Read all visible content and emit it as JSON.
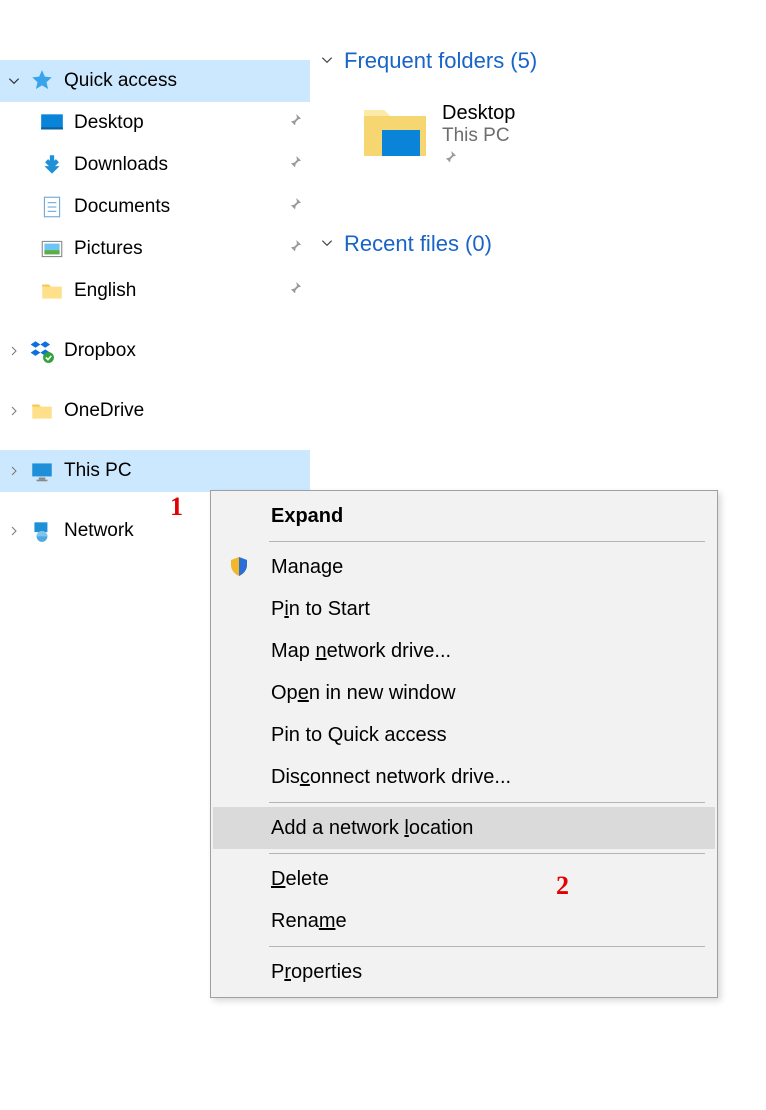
{
  "sidebar": {
    "quick_access": "Quick access",
    "items": [
      {
        "label": "Desktop"
      },
      {
        "label": "Downloads"
      },
      {
        "label": "Documents"
      },
      {
        "label": "Pictures"
      },
      {
        "label": "English"
      }
    ],
    "dropbox": "Dropbox",
    "onedrive": "OneDrive",
    "this_pc": "This PC",
    "network": "Network"
  },
  "content": {
    "frequent_hdr": "Frequent folders (5)",
    "recent_hdr": "Recent files (0)",
    "tile": {
      "name": "Desktop",
      "sub": "This PC"
    }
  },
  "ctx": {
    "expand": "Expand",
    "manage": "Manage",
    "pin_start_pre": "P",
    "pin_start_ul": "i",
    "pin_start_post": "n to Start",
    "map_pre": "Map ",
    "map_ul": "n",
    "map_post": "etwork drive...",
    "open_pre": "Op",
    "open_ul": "e",
    "open_post": "n in new window",
    "pin_qa": "Pin to Quick access",
    "disc_pre": "Dis",
    "disc_ul": "c",
    "disc_post": "onnect network drive...",
    "add_pre": "Add a network ",
    "add_ul": "l",
    "add_post": "ocation",
    "del_ul": "D",
    "del_post": "elete",
    "ren_pre": "Rena",
    "ren_ul": "m",
    "ren_post": "e",
    "prop_pre": "P",
    "prop_ul": "r",
    "prop_post": "operties"
  },
  "annot": {
    "one": "1",
    "two": "2"
  }
}
